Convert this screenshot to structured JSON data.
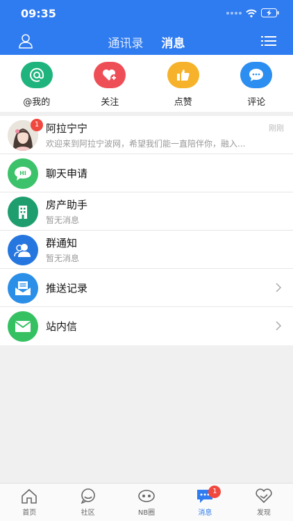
{
  "status_bar": {
    "time": "09:35"
  },
  "nav": {
    "tabs": [
      {
        "label": "通讯录",
        "active": false
      },
      {
        "label": "消息",
        "active": true
      }
    ]
  },
  "quick_actions": [
    {
      "label": "@我的",
      "icon": "at-icon",
      "color": "#1fb47e"
    },
    {
      "label": "关注",
      "icon": "heart-plus-icon",
      "color": "#ee4f57"
    },
    {
      "label": "点赞",
      "icon": "thumbs-up-icon",
      "color": "#f6b22a"
    },
    {
      "label": "评论",
      "icon": "comment-icon",
      "color": "#2b8ef0"
    }
  ],
  "messages": [
    {
      "title": "阿拉宁宁",
      "subtitle": "欢迎来到阿拉宁波网，希望我们能一直陪伴你，融入...",
      "time": "刚刚",
      "badge": "1",
      "icon": "avatar"
    },
    {
      "title": "聊天申请",
      "icon": "chat-hi-icon",
      "color": "#3cc26a"
    },
    {
      "title": "房产助手",
      "subtitle": "暂无消息",
      "icon": "building-icon",
      "color": "#1e9e6e"
    },
    {
      "title": "群通知",
      "subtitle": "暂无消息",
      "icon": "group-icon",
      "color": "#2676e0"
    },
    {
      "title": "推送记录",
      "icon": "inbox-icon",
      "color": "#2b8fe8",
      "arrow": true
    },
    {
      "title": "站内信",
      "icon": "envelope-icon",
      "color": "#35c162",
      "arrow": true
    }
  ],
  "tabbar": [
    {
      "label": "首页",
      "icon": "home-icon"
    },
    {
      "label": "社区",
      "icon": "community-icon"
    },
    {
      "label": "NB圈",
      "icon": "nb-circle-icon"
    },
    {
      "label": "消息",
      "icon": "message-icon",
      "active": true,
      "badge": "1"
    },
    {
      "label": "发现",
      "icon": "discover-icon"
    }
  ],
  "colors": {
    "header": "#2f7bf0",
    "badge": "#f0483e",
    "active_tab": "#2f7bf0"
  }
}
